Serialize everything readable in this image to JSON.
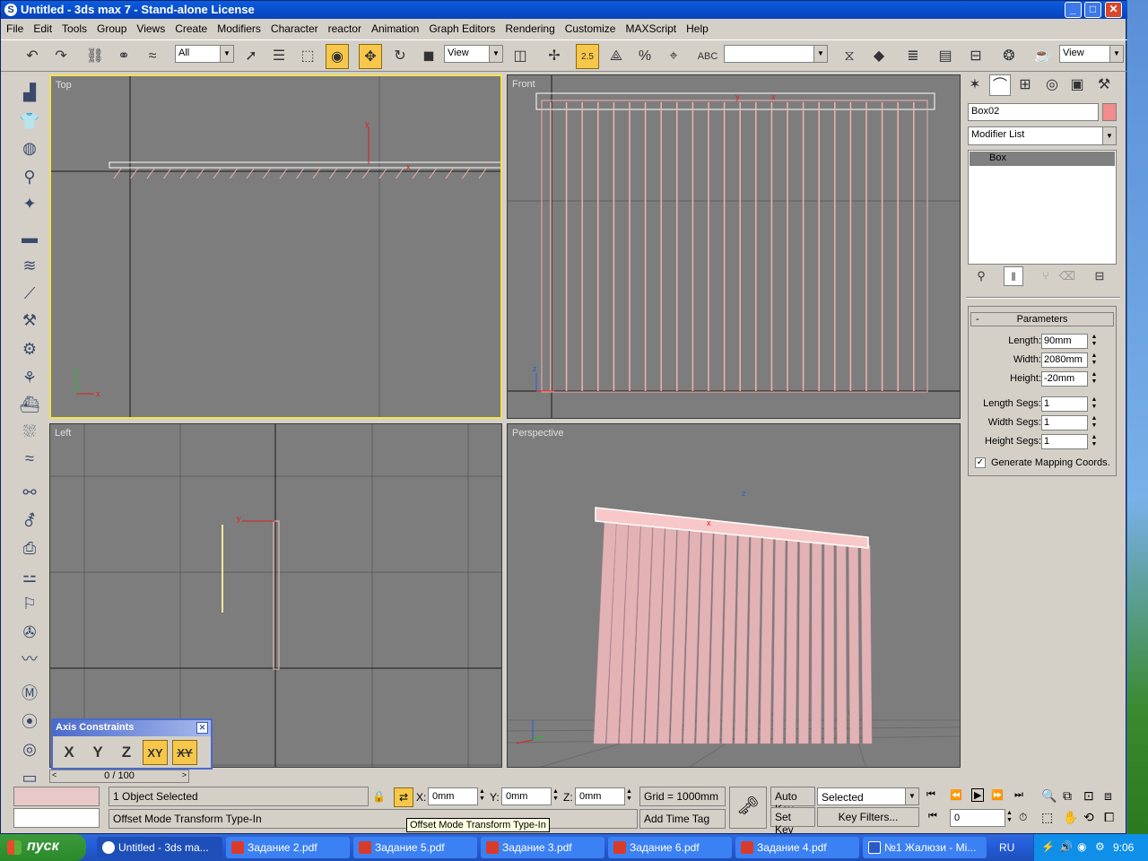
{
  "window": {
    "title": "Untitled - 3ds max 7  - Stand-alone License",
    "min": "_",
    "max": "□",
    "close": "✕"
  },
  "menu": [
    "File",
    "Edit",
    "Tools",
    "Group",
    "Views",
    "Create",
    "Modifiers",
    "Character",
    "reactor",
    "Animation",
    "Graph Editors",
    "Rendering",
    "Customize",
    "MAXScript",
    "Help"
  ],
  "toolbar": {
    "selection_filter": "All",
    "ref_coord": "View",
    "snap_value": "2.5",
    "named_selection": "",
    "render_view": "View"
  },
  "viewports": {
    "top": "Top",
    "front": "Front",
    "left": "Left",
    "perspective": "Perspective"
  },
  "command_panel": {
    "object_name": "Box02",
    "object_color": "#f28c8c",
    "modifier_list": "Modifier List",
    "stack_item": "Box",
    "rollout_title": "Parameters",
    "rollout_toggle": "-",
    "params": [
      {
        "label": "Length:",
        "value": "90mm"
      },
      {
        "label": "Width:",
        "value": "2080mm"
      },
      {
        "label": "Height:",
        "value": "-20mm"
      },
      {
        "label": "Length Segs:",
        "value": "1"
      },
      {
        "label": "Width Segs:",
        "value": "1"
      },
      {
        "label": "Height Segs:",
        "value": "1"
      }
    ],
    "generate_mapping": "Generate Mapping Coords."
  },
  "axis_constraints": {
    "title": "Axis Constraints",
    "close": "✕",
    "x": "X",
    "y": "Y",
    "z": "Z",
    "xy": "XY",
    "xy2": "XY"
  },
  "timeline": {
    "frame": "0 / 100"
  },
  "status": {
    "selection": "1 Object Selected",
    "prompt": "Offset Mode Transform Type-In",
    "x_label": "X:",
    "x_value": "0mm",
    "y_label": "Y:",
    "y_value": "0mm",
    "z_label": "Z:",
    "z_value": "0mm",
    "grid": "Grid = 1000mm",
    "add_time_tag": "Add Time Tag",
    "auto_key": "Auto Key",
    "set_key": "Set Key",
    "key_mode": "Selected",
    "key_filters": "Key Filters...",
    "current_frame": "0",
    "tooltip": "Offset Mode Transform Type-In"
  },
  "taskbar": {
    "start": "пуск",
    "tasks": [
      {
        "label": "Untitled - 3ds ma...",
        "kind": "app"
      },
      {
        "label": "Задание 2.pdf",
        "kind": "pdf"
      },
      {
        "label": "Задание 5.pdf",
        "kind": "pdf"
      },
      {
        "label": "Задание 3.pdf",
        "kind": "pdf"
      },
      {
        "label": "Задание 6.pdf",
        "kind": "pdf"
      },
      {
        "label": "Задание 4.pdf",
        "kind": "pdf"
      },
      {
        "label": "№1 Жалюзи - Mi...",
        "kind": "word"
      }
    ],
    "lang": "RU",
    "clock": "9:06"
  }
}
